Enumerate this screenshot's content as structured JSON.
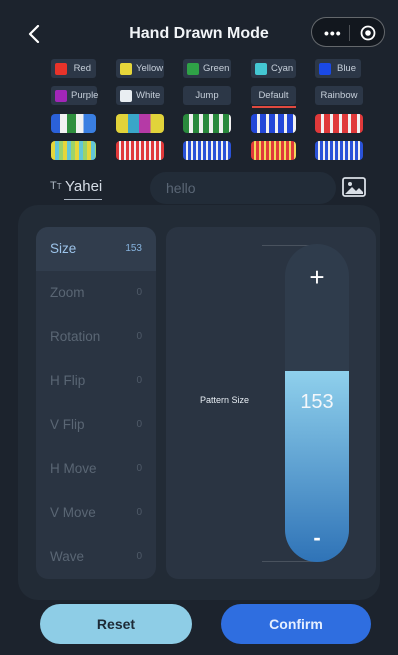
{
  "header": {
    "title": "Hand Drawn Mode",
    "back_icon": "chevron-left-icon",
    "menu_icon": "more-dots-icon",
    "target_icon": "record-target-icon"
  },
  "colors": [
    {
      "label": "Red",
      "swatch": "#e8332a"
    },
    {
      "label": "Yellow",
      "swatch": "#e6d63a"
    },
    {
      "label": "Green",
      "swatch": "#2fa247"
    },
    {
      "label": "Cyan",
      "swatch": "#44c7d3"
    },
    {
      "label": "Blue",
      "swatch": "#1a49e6"
    },
    {
      "label": "Purple",
      "swatch": "#a226b8"
    },
    {
      "label": "White",
      "swatch": "#e9eef2"
    }
  ],
  "modes": {
    "jump": "Jump",
    "default": "Default",
    "rainbow": "Rainbow",
    "selected_underline_color": "#e0493f"
  },
  "text_row": {
    "font_icon": "text-font-icon",
    "font_name": "Yahei",
    "input_value": "hello",
    "image_icon": "image-icon"
  },
  "properties": [
    {
      "name": "Size",
      "value": "153"
    },
    {
      "name": "Zoom",
      "value": "0"
    },
    {
      "name": "Rotation",
      "value": "0"
    },
    {
      "name": "H Flip",
      "value": "0"
    },
    {
      "name": "V Flip",
      "value": "0"
    },
    {
      "name": "H Move",
      "value": "0"
    },
    {
      "name": "V Move",
      "value": "0"
    },
    {
      "name": "Wave",
      "value": "0"
    }
  ],
  "slider": {
    "label": "Pattern Size",
    "value": "153",
    "plus": "+",
    "minus": "-",
    "fill_fraction": 0.6,
    "fill_color_top": "#8fd0ec",
    "fill_color_bottom": "#2f73b7"
  },
  "buttons": {
    "reset": "Reset",
    "confirm": "Confirm"
  }
}
